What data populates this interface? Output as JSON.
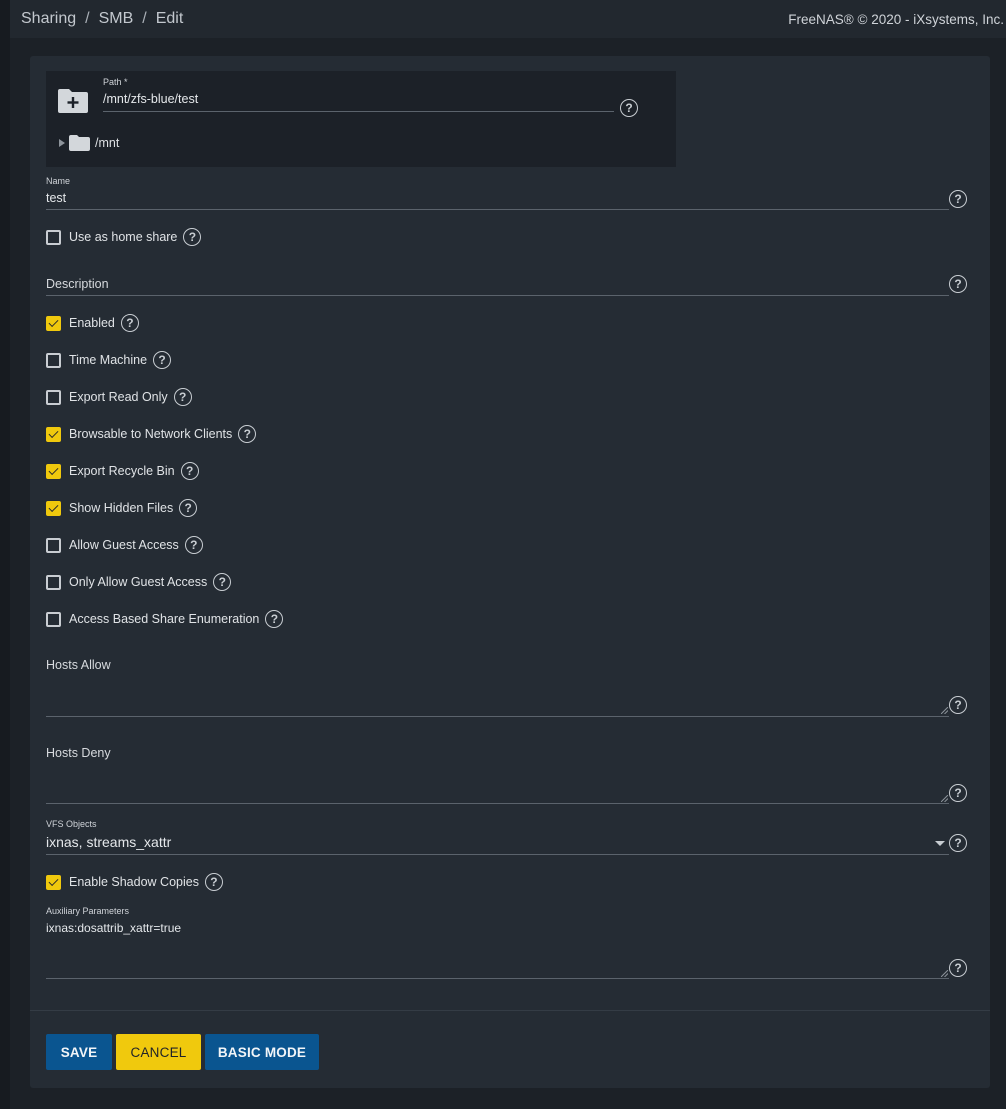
{
  "breadcrumb": [
    "Sharing",
    "SMB",
    "Edit"
  ],
  "copyright": "FreeNAS® © 2020 - iXsystems, Inc.",
  "path": {
    "label": "Path *",
    "value": "/mnt/zfs-blue/test",
    "tree_root": "/mnt"
  },
  "name": {
    "label": "Name",
    "value": "test"
  },
  "description": {
    "placeholder": "Description"
  },
  "checkboxes": [
    {
      "label": "Use as home share",
      "checked": false
    },
    {
      "label": "Enabled",
      "checked": true
    },
    {
      "label": "Time Machine",
      "checked": false
    },
    {
      "label": "Export Read Only",
      "checked": false
    },
    {
      "label": "Browsable to Network Clients",
      "checked": true
    },
    {
      "label": "Export Recycle Bin",
      "checked": true
    },
    {
      "label": "Show Hidden Files",
      "checked": true
    },
    {
      "label": "Allow Guest Access",
      "checked": false
    },
    {
      "label": "Only Allow Guest Access",
      "checked": false
    },
    {
      "label": "Access Based Share Enumeration",
      "checked": false
    },
    {
      "label": "Enable Shadow Copies",
      "checked": true
    }
  ],
  "hosts_allow": {
    "label": "Hosts Allow"
  },
  "hosts_deny": {
    "label": "Hosts Deny"
  },
  "vfs": {
    "label": "VFS Objects",
    "value": "ixnas, streams_xattr"
  },
  "aux": {
    "label": "Auxiliary Parameters",
    "value": "ixnas:dosattrib_xattr=true"
  },
  "buttons": {
    "save": "SAVE",
    "cancel": "CANCEL",
    "basic": "BASIC MODE"
  },
  "colors": {
    "accent_yellow": "#f0c90d",
    "primary_blue": "#0a5590",
    "card_bg": "#252c34"
  }
}
